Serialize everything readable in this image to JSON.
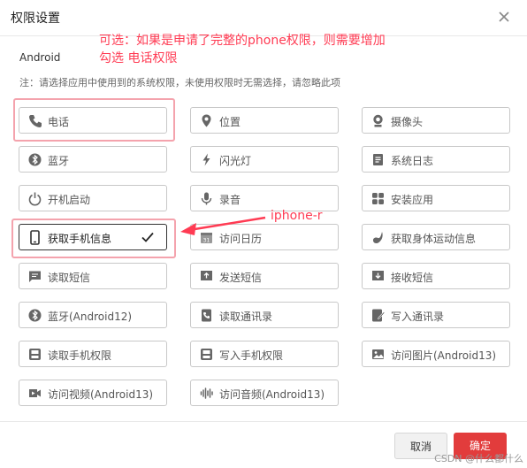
{
  "dialog": {
    "title": "权限设置",
    "platform": "Android",
    "hint": "注：请选择应用中使用到的系统权限，未使用权限时无需选择，请忽略此项"
  },
  "annotations": {
    "top_line1": "可选：如果是申请了完整的phone权限，则需要增加",
    "top_line2": "勾选 电话权限",
    "arrow_label": "iphone-r",
    "color": "#ff3b53"
  },
  "permissions": [
    {
      "label": "电话",
      "icon": "phone-icon"
    },
    {
      "label": "位置",
      "icon": "location-icon"
    },
    {
      "label": "摄像头",
      "icon": "camera-icon"
    },
    {
      "label": "蓝牙",
      "icon": "bluetooth-icon"
    },
    {
      "label": "闪光灯",
      "icon": "flash-icon"
    },
    {
      "label": "系统日志",
      "icon": "log-icon"
    },
    {
      "label": "开机启动",
      "icon": "power-icon"
    },
    {
      "label": "录音",
      "icon": "microphone-icon"
    },
    {
      "label": "安装应用",
      "icon": "apps-icon"
    },
    {
      "label": "获取手机信息",
      "icon": "phone-device-icon",
      "selected": true
    },
    {
      "label": "访问日历",
      "icon": "calendar-icon"
    },
    {
      "label": "获取身体运动信息",
      "icon": "motion-icon"
    },
    {
      "label": "读取短信",
      "icon": "sms-icon"
    },
    {
      "label": "发送短信",
      "icon": "sms-send-icon"
    },
    {
      "label": "接收短信",
      "icon": "sms-receive-icon"
    },
    {
      "label": "蓝牙(Android12)",
      "icon": "bluetooth-icon"
    },
    {
      "label": "读取通讯录",
      "icon": "contacts-icon"
    },
    {
      "label": "写入通讯录",
      "icon": "contacts-edit-icon"
    },
    {
      "label": "读取手机权限",
      "icon": "storage-icon"
    },
    {
      "label": "写入手机权限",
      "icon": "storage-icon"
    },
    {
      "label": "访问图片(Android13)",
      "icon": "image-icon"
    },
    {
      "label": "访问视频(Android13)",
      "icon": "video-icon"
    },
    {
      "label": "访问音频(Android13)",
      "icon": "audio-icon"
    }
  ],
  "footer": {
    "cancel": "取消",
    "ok": "确定"
  },
  "watermark": "CSDN @什么都什么"
}
